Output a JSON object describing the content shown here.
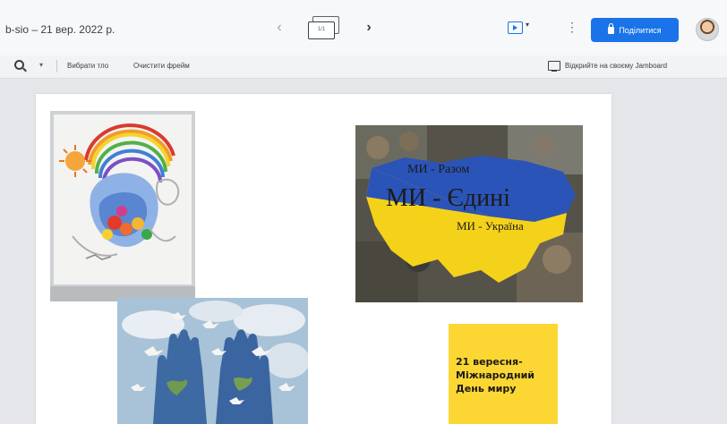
{
  "header": {
    "title": "b-sio – 21 вер. 2022 р.",
    "frame_counter": "1/1",
    "share_label": "Поділитися"
  },
  "toolbar": {
    "background_label": "Вибрати тло",
    "clear_label": "Очистити фрейм",
    "cast_label": "Відкрийте на своєму Jamboard"
  },
  "canvas": {
    "poster_ua": {
      "line1": "МИ - Разом",
      "line2": "МИ - Єдині",
      "line3": "МИ - Україна"
    },
    "peace_card": {
      "text": "21 вересня- Міжнародний День миру"
    }
  },
  "icons": [
    "zoom-icon",
    "chevron-left-icon",
    "chevron-right-icon",
    "frames-icon",
    "present-icon",
    "more-vert-icon",
    "lock-icon",
    "cast-icon"
  ],
  "colors": {
    "accent": "#1a73e8",
    "peace_card": "#fcd733",
    "flag_blue": "#2b54b8",
    "flag_yellow": "#f4d21a"
  }
}
